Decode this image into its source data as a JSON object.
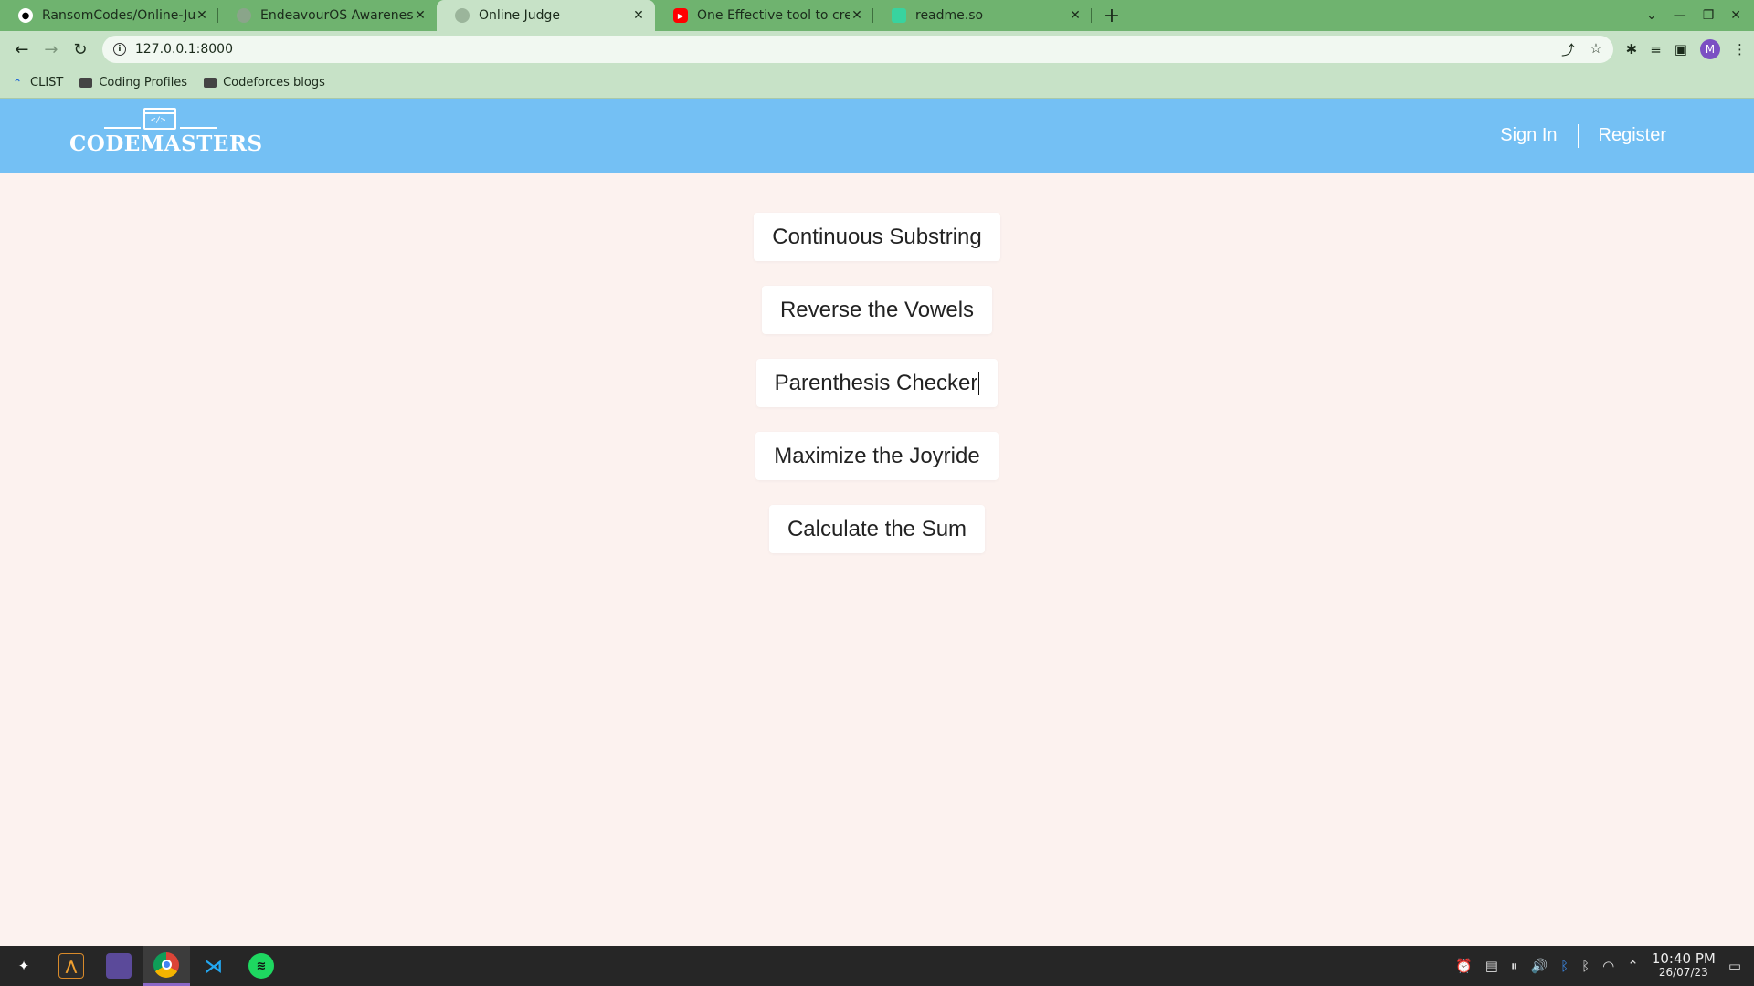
{
  "browser": {
    "tabs": [
      {
        "title": "RansomCodes/Online-Judge",
        "icon": "github-icon",
        "active": false
      },
      {
        "title": "EndeavourOS Awareness",
        "icon": "globe-icon",
        "active": false
      },
      {
        "title": "Online Judge",
        "icon": "globe-icon",
        "active": true
      },
      {
        "title": "One Effective tool to create R",
        "icon": "youtube-icon",
        "active": false
      },
      {
        "title": "readme.so",
        "icon": "readme-icon",
        "active": false
      }
    ],
    "new_tab": "+",
    "url": "127.0.0.1:8000",
    "bookmarks": [
      {
        "label": "CLIST",
        "icon": "clist-icon"
      },
      {
        "label": "Coding Profiles",
        "icon": "folder-icon"
      },
      {
        "label": "Codeforces blogs",
        "icon": "folder-icon"
      }
    ],
    "avatar_letter": "M"
  },
  "site": {
    "logo_text": "CODEMASTERS",
    "logo_code": "</>",
    "nav": {
      "sign_in": "Sign In",
      "register": "Register"
    },
    "header_color": "#74c0f4",
    "background_color": "#fcf2ef"
  },
  "problems": [
    "Continuous Substring",
    "Reverse the Vowels",
    "Parenthesis Checker",
    "Maximize the Joyride",
    "Calculate the Sum"
  ],
  "taskbar": {
    "apps": [
      "launcher-icon",
      "app-icon",
      "files-icon",
      "chrome-icon",
      "vscode-icon",
      "spotify-icon"
    ],
    "time": "10:40 PM",
    "date": "26/07/23"
  }
}
